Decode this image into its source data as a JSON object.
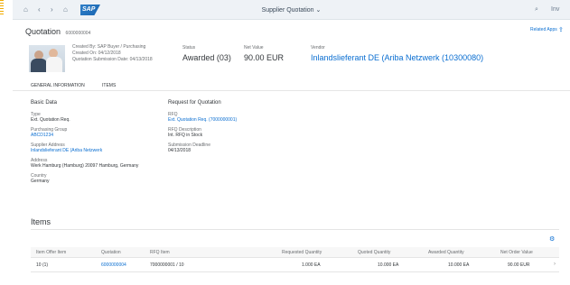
{
  "shell": {
    "back_icon": "home-icon",
    "logo": "SAP",
    "title": "Supplier Quotation ⌄",
    "search_icon": "search-icon",
    "menu_label": "Inv"
  },
  "header": {
    "title": "Quotation",
    "subtitle": "6000000004",
    "created_by": "Created By: SAP Buyer / Purchasing",
    "created_on": "Created On: 04/12/2018",
    "deadline": "Quotation Submission Date: 04/13/2018",
    "status_label": "Status",
    "status_value": "Awarded (03)",
    "net_value_label": "Net Value",
    "net_value": "90.00  EUR",
    "supplier_label": "Vendor",
    "supplier_value": "Inlandslieferant DE (Ariba Netzwerk (10300080)",
    "related_apps": "Related Apps",
    "share_icon": "share-icon"
  },
  "tabs": [
    "GENERAL INFORMATION",
    "ITEMS"
  ],
  "general": {
    "basic_data_title": "Basic Data",
    "rfq_title": "Request for Quotation",
    "type_label": "Type",
    "type_value": "Ext. Quotation Req.",
    "pur_org_label": "Purchasing Group",
    "pur_org_value": "ABCD1234",
    "supplier_label": "Supplier Address",
    "supplier_value": "Inlandslieferant DE (Ariba Netzwerk",
    "address_label": "Address",
    "address_value": "Werk Hamburg (Hamburg) 20097 Hamburg, Germany",
    "country_label": "Country",
    "country_value": "Germany",
    "rfq_label": "RFQ",
    "rfq_value": "Ext. Quotation Req. (7000000001)",
    "rfq_desc_label": "RFQ Description",
    "rfq_desc_value": "Int. RFQ in Stock",
    "submission_label": "Submission Deadline",
    "submission_value": "04/13/2018"
  },
  "items": {
    "title": "Items",
    "settings_icon": "settings-icon",
    "columns": [
      "Item  Offer Item",
      "Quotation",
      "RFQ Item",
      "Requested Quantity",
      "Quoted Quantity",
      "Awarded Quantity",
      "Net Order Value"
    ],
    "rows": [
      {
        "item": "10 (1)",
        "quotation": "6000000004",
        "rfq_item": "7000000001 / 10",
        "requested": "1.000  EA",
        "quoted": "10.000  EA",
        "awarded": "10.000  EA",
        "net_value": "90.00  EUR"
      }
    ]
  },
  "colors": {
    "accent": "#0a6ed1",
    "shell": "#eef2f6",
    "marker": "#f0ab00"
  }
}
